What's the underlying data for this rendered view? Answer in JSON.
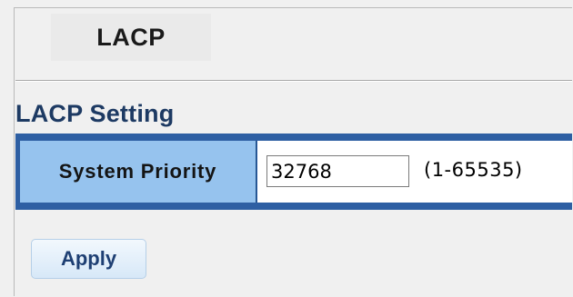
{
  "page": {
    "title": "LACP"
  },
  "lacp_setting": {
    "section_title": "LACP Setting",
    "system_priority": {
      "label": "System Priority",
      "value": "32768",
      "range_hint": "(1-65535)"
    }
  },
  "actions": {
    "apply_label": "Apply"
  },
  "colors": {
    "section_title": "#1d3a63",
    "table_border": "#2e5fa3",
    "label_cell": "#96c3ee",
    "button_text": "#1e3f73"
  }
}
